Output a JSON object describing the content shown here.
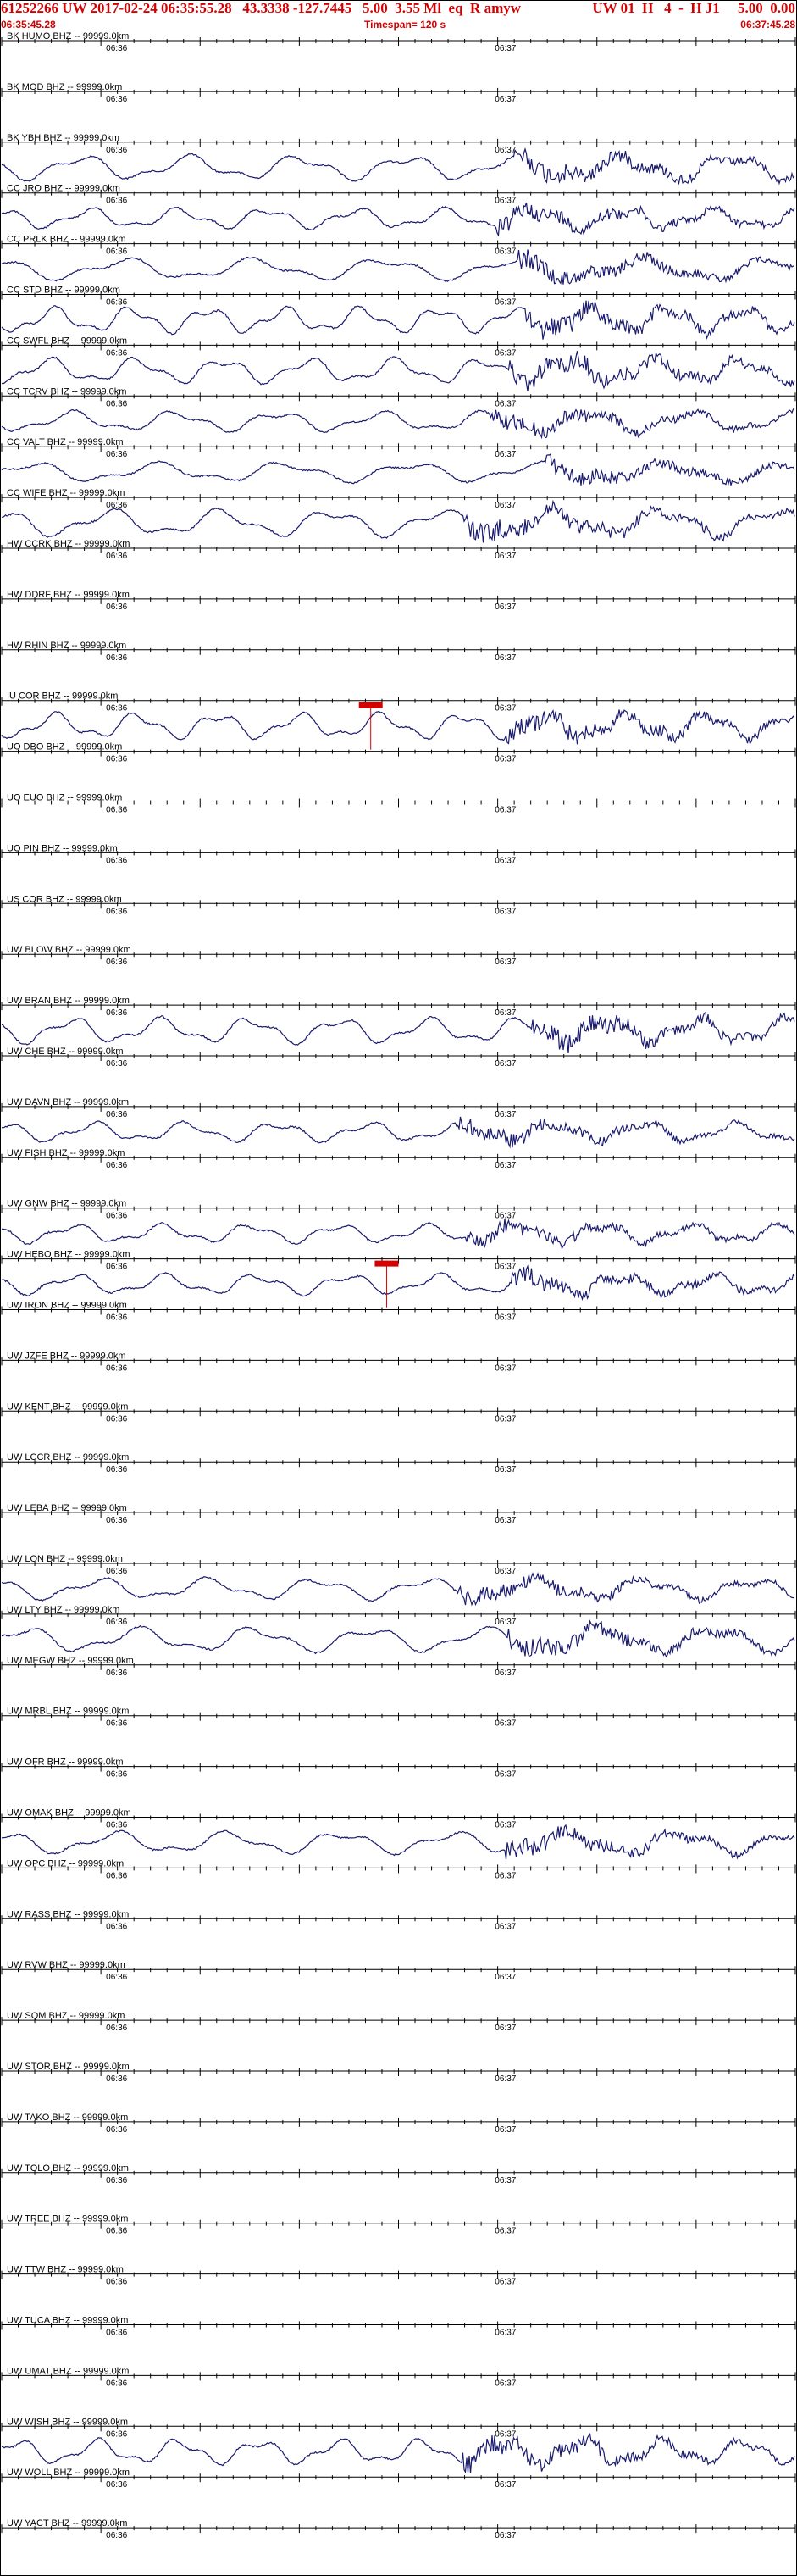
{
  "header": {
    "title": "61252266 UW 2017-02-24 06:35:55.28   43.3338 -127.7445   5.00  3.55 Ml  eq  R amyw",
    "right": "UW 01  H   4  -  H J1     5.00  0.00",
    "start_time": "06:35:45.28",
    "timespan": "Timespan= 120 s",
    "end_time": "06:37:45.28"
  },
  "tick_labels": {
    "left": "06:36",
    "right": "06:37"
  },
  "colors": {
    "trace": "#1a1a6e",
    "header": "#d40000",
    "pick": "#d40000",
    "axis": "#000000"
  },
  "channels": [
    {
      "label": "BK HUMO BHZ -- 99999.0km",
      "active": false,
      "pick": null
    },
    {
      "label": "BK MOD BHZ -- 99999.0km",
      "active": false,
      "pick": null
    },
    {
      "label": "BK YBH BHZ -- 99999.0km",
      "active": true,
      "pick": null
    },
    {
      "label": "CC JRO BHZ -- 99999.0km",
      "active": true,
      "pick": null
    },
    {
      "label": "CC PRLK BHZ -- 99999.0km",
      "active": true,
      "pick": null
    },
    {
      "label": "CC STD BHZ -- 99999.0km",
      "active": true,
      "pick": null
    },
    {
      "label": "CC SWFL BHZ -- 99999.0km",
      "active": true,
      "pick": null
    },
    {
      "label": "CC TCRV BHZ -- 99999.0km",
      "active": true,
      "pick": null
    },
    {
      "label": "CC VALT BHZ -- 99999.0km",
      "active": true,
      "pick": null
    },
    {
      "label": "CC WIFE BHZ -- 99999.0km",
      "active": true,
      "pick": null
    },
    {
      "label": "HW CCRK BHZ -- 99999.0km",
      "active": false,
      "pick": null
    },
    {
      "label": "HW DDRF BHZ -- 99999.0km",
      "active": false,
      "pick": null
    },
    {
      "label": "HW RHIN BHZ -- 99999.0km",
      "active": false,
      "pick": null
    },
    {
      "label": "IU COR BHZ -- 99999.0km",
      "active": true,
      "pick": 0.465
    },
    {
      "label": "UO DBO BHZ -- 99999.0km",
      "active": false,
      "pick": null
    },
    {
      "label": "UO EUO BHZ -- 99999.0km",
      "active": false,
      "pick": null
    },
    {
      "label": "UO PIN BHZ -- 99999.0km",
      "active": false,
      "pick": null
    },
    {
      "label": "US COR BHZ -- 99999.0km",
      "active": false,
      "pick": null
    },
    {
      "label": "UW BLOW BHZ -- 99999.0km",
      "active": false,
      "pick": null
    },
    {
      "label": "UW BRAN BHZ -- 99999.0km",
      "active": true,
      "pick": null
    },
    {
      "label": "UW CHE BHZ -- 99999.0km",
      "active": false,
      "pick": null
    },
    {
      "label": "UW DAVN BHZ -- 99999.0km",
      "active": true,
      "pick": null
    },
    {
      "label": "UW FISH BHZ -- 99999.0km",
      "active": false,
      "pick": null
    },
    {
      "label": "UW GNW BHZ -- 99999.0km",
      "active": true,
      "pick": null
    },
    {
      "label": "UW HEBO BHZ -- 99999.0km",
      "active": true,
      "pick": 0.485
    },
    {
      "label": "UW IRON BHZ -- 99999.0km",
      "active": false,
      "pick": null
    },
    {
      "label": "UW JZFE BHZ -- 99999.0km",
      "active": false,
      "pick": null
    },
    {
      "label": "UW KENT BHZ -- 99999.0km",
      "active": false,
      "pick": null
    },
    {
      "label": "UW LCCR BHZ -- 99999.0km",
      "active": false,
      "pick": null
    },
    {
      "label": "UW LEBA BHZ -- 99999.0km",
      "active": false,
      "pick": null
    },
    {
      "label": "UW LON BHZ -- 99999.0km",
      "active": true,
      "pick": null
    },
    {
      "label": "UW LTY BHZ -- 99999.0km",
      "active": true,
      "pick": null
    },
    {
      "label": "UW MEGW BHZ -- 99999.0km",
      "active": false,
      "pick": null
    },
    {
      "label": "UW MRBL BHZ -- 99999.0km",
      "active": false,
      "pick": null
    },
    {
      "label": "UW OFR BHZ -- 99999.0km",
      "active": false,
      "pick": null
    },
    {
      "label": "UW OMAK BHZ -- 99999.0km",
      "active": true,
      "pick": null
    },
    {
      "label": "UW OPC BHZ -- 99999.0km",
      "active": false,
      "pick": null
    },
    {
      "label": "UW RASS BHZ -- 99999.0km",
      "active": false,
      "pick": null
    },
    {
      "label": "UW RVW BHZ -- 99999.0km",
      "active": false,
      "pick": null
    },
    {
      "label": "UW SQM BHZ -- 99999.0km",
      "active": false,
      "pick": null
    },
    {
      "label": "UW STOR BHZ -- 99999.0km",
      "active": false,
      "pick": null
    },
    {
      "label": "UW TAKO BHZ -- 99999.0km",
      "active": false,
      "pick": null
    },
    {
      "label": "UW TOLO BHZ -- 99999.0km",
      "active": false,
      "pick": null
    },
    {
      "label": "UW TREE BHZ -- 99999.0km",
      "active": false,
      "pick": null
    },
    {
      "label": "UW TTW BHZ -- 99999.0km",
      "active": false,
      "pick": null
    },
    {
      "label": "UW TUCA BHZ -- 99999.0km",
      "active": false,
      "pick": null
    },
    {
      "label": "UW UMAT BHZ -- 99999.0km",
      "active": false,
      "pick": null
    },
    {
      "label": "UW WISH BHZ -- 99999.0km",
      "active": true,
      "pick": null
    },
    {
      "label": "UW WOLL BHZ -- 99999.0km",
      "active": false,
      "pick": null
    },
    {
      "label": "UW YACT BHZ -- 99999.0km",
      "active": false,
      "pick": null
    }
  ]
}
